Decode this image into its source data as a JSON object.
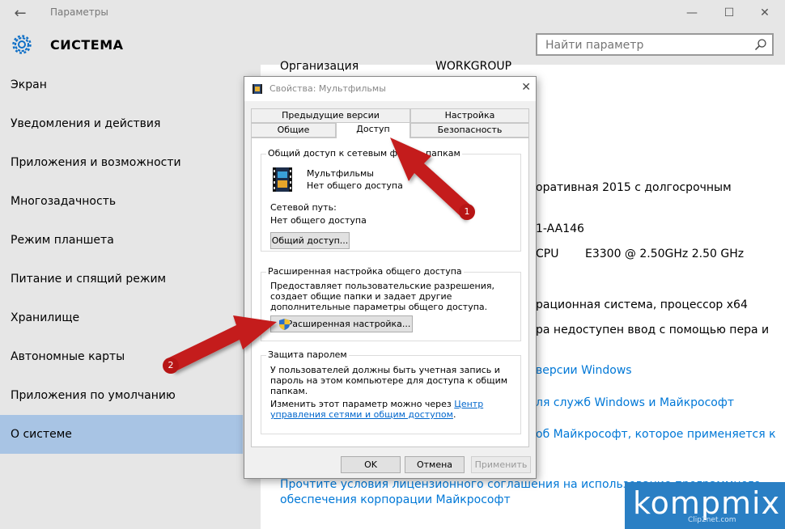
{
  "window": {
    "title": "Параметры",
    "back_icon": "back-arrow-icon",
    "minimize": "—",
    "maximize": "☐",
    "close": "✕"
  },
  "header": {
    "title": "СИСТЕМА",
    "search_placeholder": "Найти параметр"
  },
  "sidebar": {
    "items": [
      {
        "label": "Экран"
      },
      {
        "label": "Уведомления и действия"
      },
      {
        "label": "Приложения и возможности"
      },
      {
        "label": "Многозадачность"
      },
      {
        "label": "Режим планшета"
      },
      {
        "label": "Питание и спящий режим"
      },
      {
        "label": "Хранилище"
      },
      {
        "label": "Автономные карты"
      },
      {
        "label": "Приложения по умолчанию"
      },
      {
        "label": "О системе"
      }
    ],
    "active_index": 9
  },
  "main": {
    "org_label": "Организация",
    "org_value": "WORKGROUP",
    "edition": "оративная 2015 с долгосрочным",
    "product_id": "1-AA146",
    "cpu_label": "CPU",
    "cpu_value": "E3300  @ 2.50GHz   2.50 GHz",
    "system_type": "рационная система, процессор x64",
    "pen": "ра недоступен ввод с помощью пера и",
    "link_versions": "версии Windows",
    "link_services": "ля служб Windows и Майкрософт",
    "link_ms": "об Майкрософт, которое применяется к",
    "link_license_1": "Прочтите условия лицензионного соглашения на использование программного",
    "link_license_2": "обеспечения корпорации Майкрософт"
  },
  "dialog": {
    "title": "Свойства: Мультфильмы",
    "close": "✕",
    "tabs_back": [
      "Предыдущие версии",
      "Настройка"
    ],
    "tabs_front": [
      "Общие",
      "Доступ",
      "Безопасность"
    ],
    "active_tab": "Доступ",
    "share_group_title": "Общий доступ к сетевым файл... папкам",
    "folder_name": "Мультфильмы",
    "folder_status": "Нет общего доступа",
    "network_path_label": "Сетевой путь:",
    "network_path_value": "Нет общего доступа",
    "share_button": "Общий доступ...",
    "advanced_group_title": "Расширенная настройка общего доступа",
    "advanced_desc": "Предоставляет пользовательские разрешения, создает общие папки и задает другие дополнительные параметры общего доступа.",
    "advanced_button": "Расширенная настройка...",
    "password_group_title": "Защита паролем",
    "password_desc": "У пользователей должны быть учетная запись и пароль на этом компьютере для доступа к общим папкам.",
    "password_change_prefix": "Изменить этот параметр можно через ",
    "password_change_link": "Центр управления сетями и общим доступом",
    "ok": "OK",
    "cancel": "Отмена",
    "apply": "Применить"
  },
  "annotations": {
    "arrow1_badge": "1",
    "arrow2_badge": "2",
    "color": "#c41b1b"
  },
  "watermark": {
    "logo": "kompmix",
    "sub": "Clip2net.com"
  },
  "colors": {
    "sidebar_bg": "#e6e6e6",
    "active_item": "#a8c4e4",
    "link": "#0078d7"
  }
}
